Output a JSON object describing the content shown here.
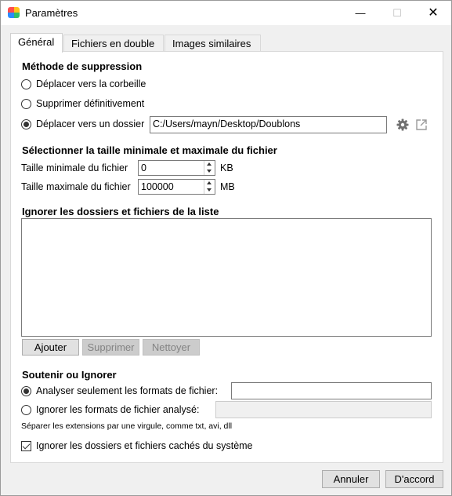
{
  "window": {
    "title": "Paramètres",
    "controls": {
      "minimize": "—",
      "maximize": "☐",
      "close": "✕"
    }
  },
  "tabs": [
    {
      "label": "Général",
      "active": true
    },
    {
      "label": "Fichiers en double",
      "active": false
    },
    {
      "label": "Images similaires",
      "active": false
    }
  ],
  "deletion": {
    "heading": "Méthode de suppression",
    "options": [
      {
        "label": "Déplacer vers la corbeille",
        "checked": false
      },
      {
        "label": "Supprimer définitivement",
        "checked": false
      },
      {
        "label": "Déplacer vers un dossier",
        "checked": true
      }
    ],
    "folder_path": "C:/Users/mayn/Desktop/Doublons",
    "settings_icon": "gear-icon",
    "open_icon": "external-link-icon"
  },
  "size": {
    "heading": "Sélectionner la taille minimale et maximale du fichier",
    "min_label": "Taille minimale du fichier",
    "min_value": "0",
    "min_unit": "KB",
    "max_label": "Taille maximale du fichier",
    "max_value": "100000",
    "max_unit": "MB"
  },
  "ignore_list": {
    "heading": "Ignorer les dossiers et fichiers de la liste",
    "items": [],
    "add_button": "Ajouter",
    "remove_button": "Supprimer",
    "clear_button": "Nettoyer"
  },
  "formats": {
    "heading": "Soutenir ou Ignorer",
    "analyze_label": "Analyser seulement les formats de fichier:",
    "analyze_checked": true,
    "analyze_value": "",
    "ignore_label": "Ignorer les formats de fichier analysé:",
    "ignore_checked": false,
    "ignore_value": "",
    "hint": "Séparer les extensions par une virgule, comme txt, avi, dll"
  },
  "hidden": {
    "label": "Ignorer les dossiers et fichiers cachés du système",
    "checked": true
  },
  "footer": {
    "cancel": "Annuler",
    "ok": "D'accord"
  }
}
